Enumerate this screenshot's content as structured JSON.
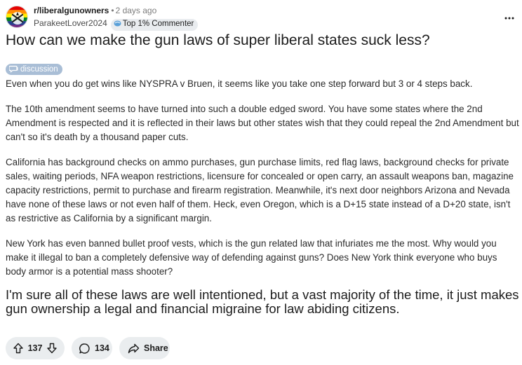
{
  "post": {
    "subreddit": "r/liberalgunowners",
    "separator": "•",
    "time": "2 days ago",
    "author": "ParakeetLover2024",
    "author_flair": "Top 1% Commenter",
    "title": "How can we make the gun laws of super liberal states suck less?",
    "tag": "discussion",
    "paragraphs": [
      "Even when you do get wins like NYSPRA v Bruen, it seems like you take one step forward but 3 or 4 steps back.",
      "The 10th amendment seems to have turned into such a double edged sword. You have some states where the 2nd Amendment is respected and it is reflected in their laws but other states wish that they could repeal the 2nd Amendment but can't so it's death by a thousand paper cuts.",
      "California has background checks on ammo purchases, gun purchase limits, red flag laws, background checks for private sales, waiting periods, NFA weapon restrictions, licensure for concealed or open carry, an assault weapons ban, magazine capacity restrictions, permit to purchase and firearm registration. Meanwhile, it's next door neighbors Arizona and Nevada have none of these laws or not even half of them. Heck, even Oregon, which is a D+15 state instead of a D+20 state, isn't as restrictive as California by a significant margin.",
      "New York has even banned bullet proof vests, which is the gun related law that infuriates me the most. Why would you make it illegal to ban a completely defensive way of defending against guns? Does New York think everyone who buys body armor is a potential mass shooter?",
      "I'm sure all of these laws are well intentioned, but a vast majority of the time, it just makes gun ownership a legal and financial migraine for law abiding citizens."
    ]
  },
  "actions": {
    "votes": "137",
    "comments": "134",
    "share_label": "Share"
  },
  "icons": {
    "avatar": "subreddit-avatar-icon",
    "flair": "commenter-badge-icon",
    "tag": "chat-bubble-icon",
    "more": "more-options-icon",
    "upvote": "upvote-icon",
    "downvote": "downvote-icon",
    "comment": "comment-icon",
    "share": "share-icon"
  },
  "colors": {
    "tag_bg": "#a9bed6",
    "pill_bg": "#eaedef",
    "flair_bg": "#e9ecef"
  }
}
